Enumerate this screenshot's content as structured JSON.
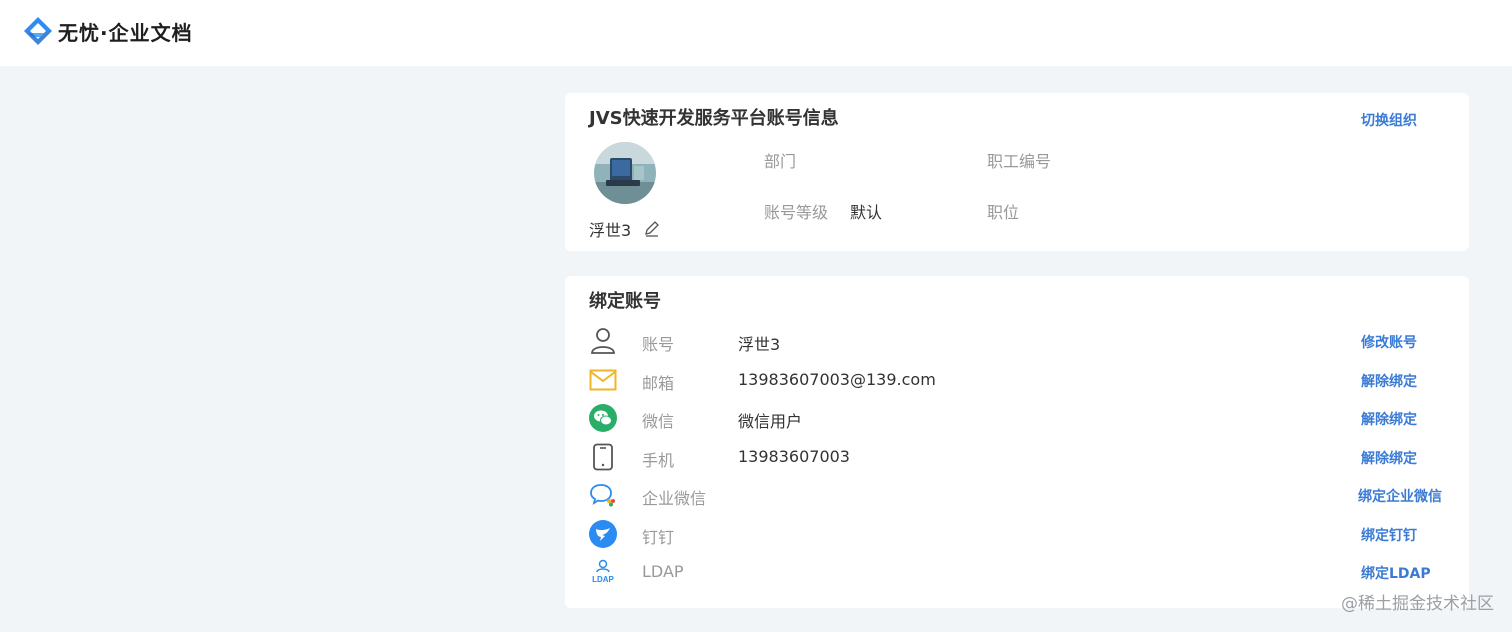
{
  "brand": {
    "name": "无忧·企业文档"
  },
  "account_card": {
    "title": "JVS快速开发服务平台账号信息",
    "switch_org_label": "切换组织",
    "username": "浮世3",
    "fields": {
      "department_label": "部门",
      "department_value": "",
      "employee_no_label": "职工编号",
      "employee_no_value": "",
      "level_label": "账号等级",
      "level_value": "默认",
      "position_label": "职位",
      "position_value": ""
    }
  },
  "bind_card": {
    "title": "绑定账号",
    "rows": [
      {
        "icon": "user-icon",
        "label": "账号",
        "value": "浮世3",
        "action": "修改账号"
      },
      {
        "icon": "mail-icon",
        "label": "邮箱",
        "value": "13983607003@139.com",
        "action": "解除绑定"
      },
      {
        "icon": "wechat-icon",
        "label": "微信",
        "value": "微信用户",
        "action": "解除绑定"
      },
      {
        "icon": "phone-icon",
        "label": "手机",
        "value": "13983607003",
        "action": "解除绑定"
      },
      {
        "icon": "wecom-icon",
        "label": "企业微信",
        "value": "",
        "action": "绑定企业微信"
      },
      {
        "icon": "dingtalk-icon",
        "label": "钉钉",
        "value": "",
        "action": "绑定钉钉"
      },
      {
        "icon": "ldap-icon",
        "label": "LDAP",
        "value": "",
        "action": "绑定LDAP"
      }
    ]
  },
  "watermark": "@稀土掘金技术社区",
  "colors": {
    "link": "#3a7bd5",
    "page_bg": "#f2f5f8",
    "label": "#999999",
    "wechat": "#2aae67",
    "dingtalk": "#2a8bf2",
    "mail": "#f0b429"
  }
}
